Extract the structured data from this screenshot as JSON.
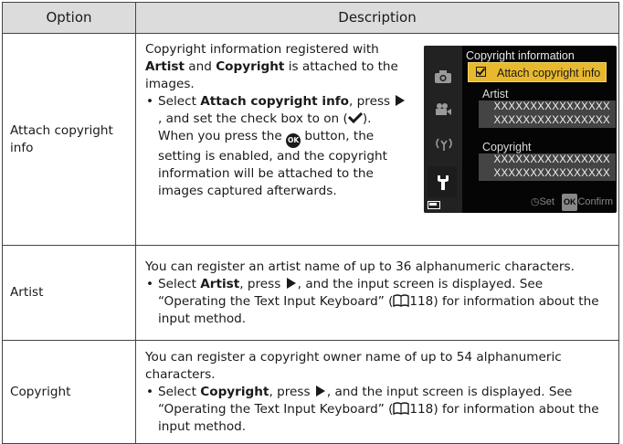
{
  "table": {
    "headers": {
      "option": "Option",
      "description": "Description"
    },
    "rows": [
      {
        "option": "Attach copyright info",
        "intro": "Copyright information registered with Artist and Copyright is attached to the images.",
        "bullet": {
          "pre": "Select ",
          "bold1": "Attach copyright info",
          "mid1": ", press ",
          "mid2": ", and set the check box to on (",
          "mid3": "). When you press the ",
          "end": " button, the setting is enabled, and the copyright information will be attached to the images captured afterwards."
        }
      },
      {
        "option": "Artist",
        "intro": "You can register an artist name of up to 36 alphanumeric characters.",
        "bullet": {
          "pre": "Select ",
          "bold1": "Artist",
          "mid1": ", press ",
          "mid2": ", and the input screen is displayed. See “Operating the Text Input Keyboard” (",
          "page": "118",
          "end": ") for information about the input method."
        }
      },
      {
        "option": "Copyright",
        "intro": "You can register a copyright owner name of up to 54 alphanumeric characters.",
        "bullet": {
          "pre": "Select ",
          "bold1": "Copyright",
          "mid1": ", press ",
          "mid2": ", and the input screen is displayed. See “Operating the Text Input Keyboard” (",
          "page": "118",
          "end": ") for information about the input method."
        }
      }
    ]
  },
  "row1_intro": {
    "pre": "Copyright information registered with ",
    "bold1": "Artist",
    "mid": " and ",
    "bold2": "Copyright",
    "post": " is attached to the images."
  },
  "camera_screen": {
    "title": "Copyright information",
    "selected_item": "Attach copyright info",
    "checked": true,
    "artist_label": "Artist",
    "artist_line1": "XXXXXXXXXXXXXXXX",
    "artist_line2": "XXXXXXXXXXXXXXXX",
    "copyright_label": "Copyright",
    "copyright_line1": "XXXXXXXXXXXXXXXX",
    "copyright_line2": "XXXXXXXXXXXXXXXX",
    "footer_set": "Set",
    "footer_ok": "OK",
    "footer_confirm": "Confirm",
    "sidebar_icons": [
      "camera-icon",
      "movie-icon",
      "wireless-icon",
      "wrench-icon"
    ],
    "accent_color": "#e8b92e"
  },
  "glyphs": {
    "ok_button": "OK"
  }
}
